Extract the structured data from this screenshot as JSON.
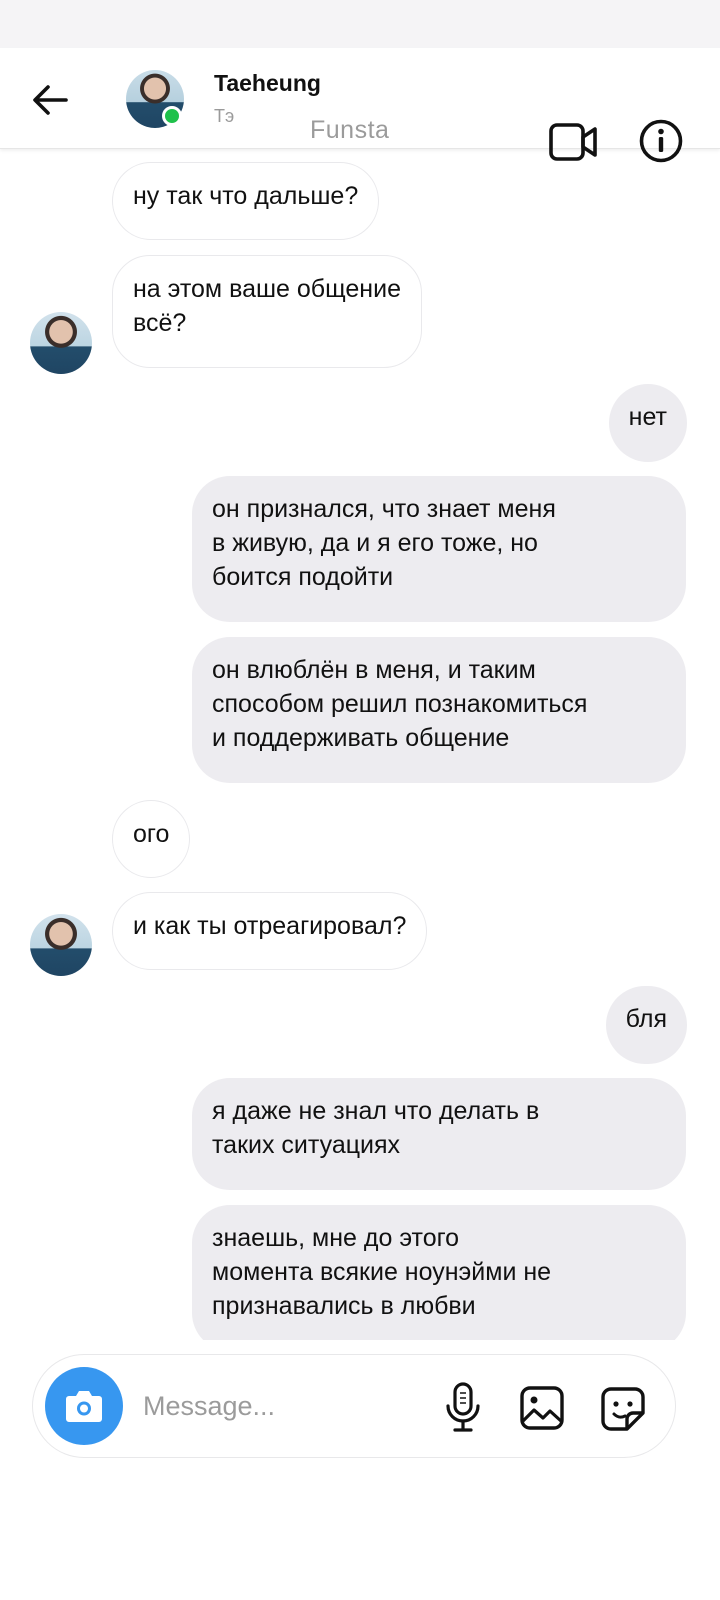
{
  "header": {
    "contact_name": "Taeheung",
    "contact_subtitle": "Тэ",
    "watermark": "Funsta"
  },
  "icons": {
    "back": "arrow-left-icon",
    "video": "video-camera-icon",
    "info": "info-icon",
    "camera": "camera-icon",
    "mic": "microphone-icon",
    "gallery": "image-icon",
    "sticker": "sticker-icon"
  },
  "colors": {
    "accent": "#3797f0",
    "online": "#1fc14b",
    "outgoing_bubble": "#edecf0",
    "incoming_bubble_border": "#e9e9ec"
  },
  "messages": [
    {
      "direction": "incoming",
      "text": "ну так что дальше?"
    },
    {
      "direction": "incoming",
      "text": "на этом ваше общение\nвсё?"
    },
    {
      "direction": "outgoing",
      "text": "нет"
    },
    {
      "direction": "outgoing",
      "text": "он признался, что знает меня\nв живую, да и я его тоже, но\nбоится подойти"
    },
    {
      "direction": "outgoing",
      "text": "он влюблён в меня, и таким\nспособом решил познакомиться\nи поддерживать общение"
    },
    {
      "direction": "incoming",
      "text": "ого"
    },
    {
      "direction": "incoming",
      "text": "и как ты отреагировал?"
    },
    {
      "direction": "outgoing",
      "text": "бля"
    },
    {
      "direction": "outgoing",
      "text": "я даже не знал что делать в\nтаких ситуациях"
    },
    {
      "direction": "outgoing",
      "text": "знаешь, мне до этого\nмомента всякие ноунэйми не\nпризнавались в любви"
    }
  ],
  "composer": {
    "placeholder": "Message..."
  }
}
